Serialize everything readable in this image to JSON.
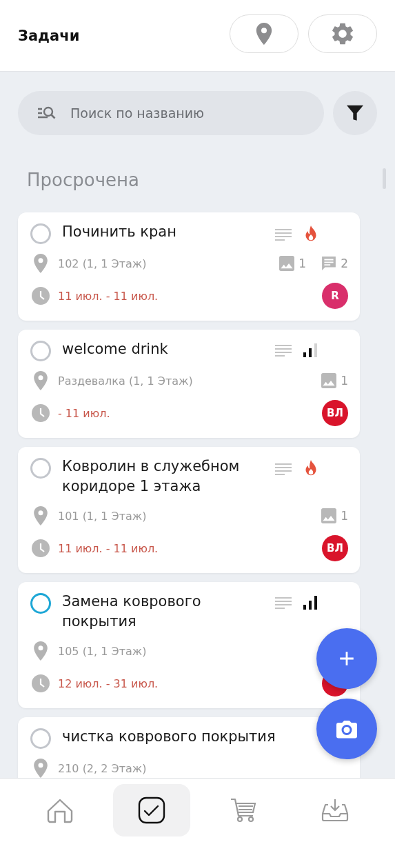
{
  "header": {
    "title": "Задачи"
  },
  "search": {
    "placeholder": "Поиск по названию"
  },
  "section": {
    "title": "Просрочена"
  },
  "tasks": [
    {
      "title": "Починить кран",
      "active": false,
      "has_description": true,
      "kind": "urgent",
      "location": "102 (1, 1 Этаж)",
      "photos": "1",
      "comments": "2",
      "dates": "11 июл. - 11 июл.",
      "assignee": {
        "initials": "R",
        "color": "#d92f6b"
      }
    },
    {
      "title": "welcome drink",
      "active": false,
      "has_description": true,
      "kind": "medium",
      "location": "Раздевалка (1, 1 Этаж)",
      "photos": "1",
      "dates": "- 11 июл.",
      "assignee": {
        "initials": "ВЛ",
        "color": "#d9142b"
      }
    },
    {
      "title": "Ковролин в служебном коридоре 1 этажа",
      "active": false,
      "has_description": true,
      "kind": "urgent",
      "location": "101 (1, 1 Этаж)",
      "photos": "1",
      "dates": "11 июл. - 11 июл.",
      "assignee": {
        "initials": "ВЛ",
        "color": "#d9142b"
      }
    },
    {
      "title": "Замена коврового покрытия",
      "active": true,
      "has_description": true,
      "kind": "high",
      "location": "105 (1, 1 Этаж)",
      "dates": "12 июл. - 31 июл.",
      "assignee": {
        "color": "#d9142b"
      }
    },
    {
      "title": "чистка коврового покрытия",
      "active": false,
      "location": "210 (2, 2 Этаж)"
    }
  ],
  "nav": [
    {
      "selected": false
    },
    {
      "selected": true
    },
    {
      "selected": false
    },
    {
      "selected": false
    }
  ]
}
